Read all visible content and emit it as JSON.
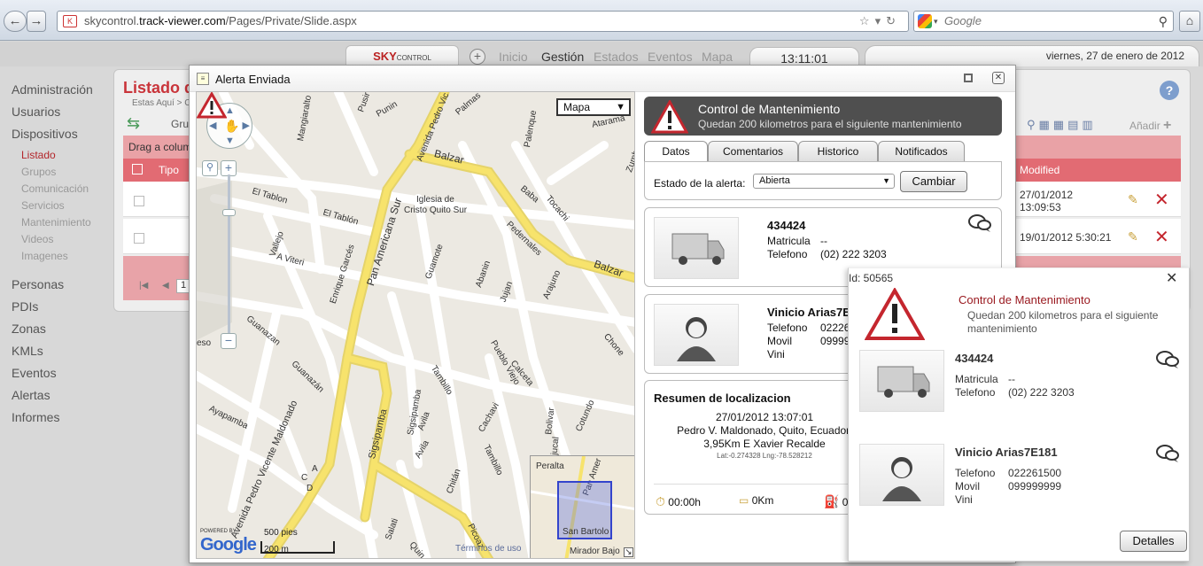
{
  "browser": {
    "url_pre": "skycontrol.",
    "url_host": "track-viewer.com",
    "url_path": "/Pages/Private/Slide.aspx",
    "search_placeholder": "Google"
  },
  "app": {
    "logo": "SKY",
    "logo_rest": "CONTROL",
    "menu": [
      "Inicio",
      "Gestión",
      "Estados",
      "Eventos",
      "Mapa"
    ],
    "menu_active": "Gestión",
    "clock": "13:11:01",
    "date": "viernes, 27 de enero de 2012"
  },
  "sidebar": {
    "groups": [
      {
        "label": "Administración"
      },
      {
        "label": "Usuarios"
      },
      {
        "label": "Dispositivos"
      },
      {
        "label": "Personas"
      },
      {
        "label": "PDIs"
      },
      {
        "label": "Zonas"
      },
      {
        "label": "KMLs"
      },
      {
        "label": "Eventos"
      },
      {
        "label": "Alertas"
      },
      {
        "label": "Informes"
      }
    ],
    "sub": [
      "Listado",
      "Grupos",
      "Comunicación",
      "Servicios",
      "Mantenimiento",
      "Videos",
      "Imagenes"
    ]
  },
  "back": {
    "title": "Listado d",
    "crumb": "Estas Aquí > C",
    "toolbar_gru": "Gru",
    "anadir": "Añadir",
    "drag": "Drag a colum",
    "col_tipo": "Tipo",
    "col_modified": "Modified",
    "rows": [
      {
        "modified_1": "27/01/2012",
        "modified_2": "13:09:53"
      },
      {
        "modified_1": "19/01/2012 5:30:21",
        "modified_2": ""
      }
    ],
    "page": "1"
  },
  "modal": {
    "title": "Alerta Enviada",
    "map": {
      "type_label": "Mapa",
      "streets": [
        "Pusir",
        "Punin",
        "Mangiaralto",
        "Avenida Pedro Vic",
        "Palmas",
        "Palenque",
        "Atarama",
        "Zumba",
        "Balzar",
        "El Tablon",
        "El Tablón",
        "Iglesia de",
        "Cristo Quito Sur",
        "Baba",
        "Tocachi",
        "Vallejo",
        "A Viteri",
        "Enrique Garcés",
        "Pan Americana Sur",
        "Guamote",
        "Abanin",
        "Pedernales",
        "Jujan",
        "Arajuno",
        "Balzar",
        "Guanazan",
        "Guanazán",
        "eso",
        "Avenida Pedro Vicente Maldonado",
        "Ayapamba",
        "Chone",
        "Sigsipamba",
        "Tambillo",
        "Pueblo Viejo",
        "Calceta",
        "Sigsipamba",
        "Avila",
        "Cachavi",
        "Cotundo",
        "Bolivar",
        "Avila",
        "Tambillo",
        "Bajucal",
        "Chitán",
        "Salati",
        "Quin",
        "Picoaz",
        "A",
        "C",
        "D"
      ],
      "overview": {
        "peralta": "Peralta",
        "pan": "Pan Amer",
        "san_bartolo": "San Bartolo",
        "mirador": "Mirador Bajo"
      },
      "powered": "POWERED BY",
      "google": "Google",
      "scale_ft": "500 pies",
      "scale_m": "200 m",
      "terms": "Términos de uso"
    },
    "banner": {
      "title": "Control de Mantenimiento",
      "subtitle": "Quedan 200 kilometros para el siguiente mantenimiento"
    },
    "tabs": [
      "Datos",
      "Comentarios",
      "Historico",
      "Notificados"
    ],
    "tab_active": "Datos",
    "estado_label": "Estado de la alerta:",
    "estado_value": "Abierta",
    "cambiar": "Cambiar",
    "vehicle": {
      "name": "434424",
      "matricula_k": "Matricula",
      "matricula_v": "--",
      "telefono_k": "Telefono",
      "telefono_v": "(02) 222 3203"
    },
    "person": {
      "name": "Vinicio Arias7E",
      "telefono_k": "Telefono",
      "telefono_v": "022261",
      "movil_k": "Movil",
      "movil_v": "099999",
      "extra": "Vini"
    },
    "loc": {
      "title": "Resumen de localizacion",
      "datetime": "27/01/2012 13:07:01",
      "line1": "Pedro V. Maldonado, Quito, Ecuador,",
      "line2": "3,95Km E Xavier Recalde",
      "coords": "Lat:-0.274328 Lng:-78.528212",
      "time": "00:00h",
      "dist": "0Km",
      "fuel": "0"
    }
  },
  "popup": {
    "id": "Id: 50565",
    "title": "Control de Mantenimiento",
    "subtitle": "Quedan 200 kilometros para el siguiente mantenimiento",
    "vehicle": {
      "name": "434424",
      "matricula_k": "Matricula",
      "matricula_v": "--",
      "telefono_k": "Telefono",
      "telefono_v": "(02) 222 3203"
    },
    "person": {
      "name": "Vinicio Arias7E181",
      "telefono_k": "Telefono",
      "telefono_v": "022261500",
      "movil_k": "Movil",
      "movil_v": "099999999",
      "extra": "Vini"
    },
    "detalles": "Detalles"
  },
  "colors": {
    "accent_red": "#c9343a",
    "banner_dark": "#4f4f4f",
    "road_yellow": "#f7e36c"
  }
}
